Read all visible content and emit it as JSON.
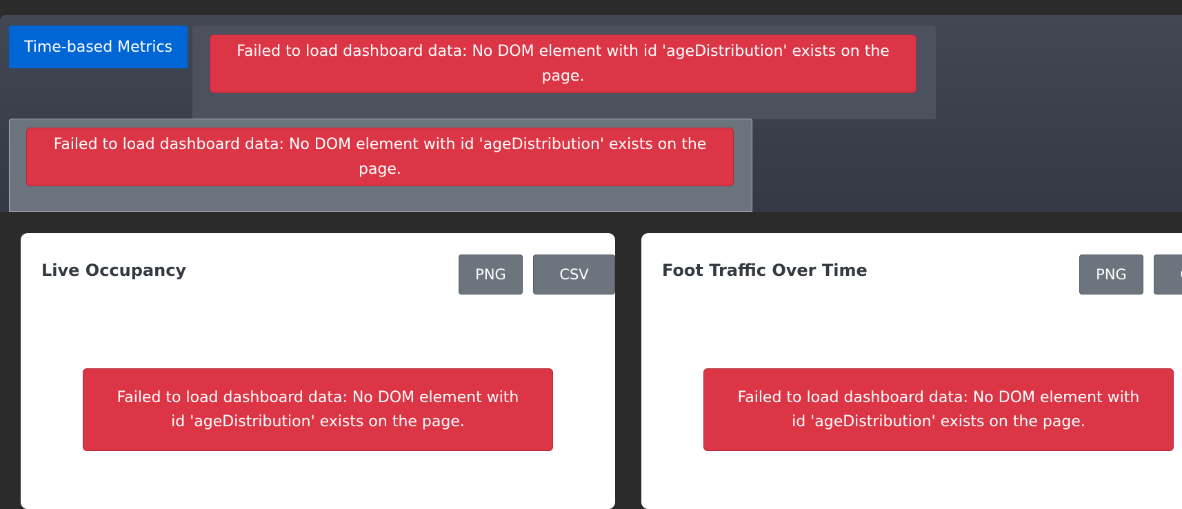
{
  "tabs": {
    "active_label": "Time-based Metrics"
  },
  "alerts": {
    "error_message": "Failed to load dashboard data: No DOM element with id 'ageDistribution' exists on the page."
  },
  "cards": [
    {
      "title": "Live Occupancy",
      "png_label": "PNG",
      "csv_label": "CSV",
      "error_message": "Failed to load dashboard data: No DOM element with id 'ageDistribution' exists on the page."
    },
    {
      "title": "Foot Traffic Over Time",
      "png_label": "PNG",
      "csv_label": "CSV",
      "error_message": "Failed to load dashboard data: No DOM element with id 'ageDistribution' exists on the page."
    }
  ],
  "colors": {
    "primary": "#0066d6",
    "danger": "#dc3545",
    "secondary": "#6c757d",
    "page_background": "#2b2b2b"
  }
}
